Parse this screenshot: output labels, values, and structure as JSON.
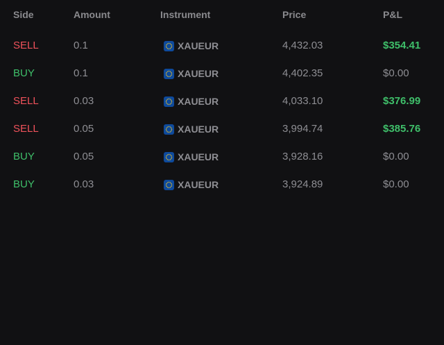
{
  "header": {
    "side": "Side",
    "amount": "Amount",
    "instrument": "Instrument",
    "price": "Price",
    "pnl": "P&L"
  },
  "colors": {
    "sell": "#f0525b",
    "buy": "#3fbf6a",
    "profit": "#3fbf6a",
    "neutral": "#8e8e93",
    "background": "#111113",
    "flag": "#0e4a9c"
  },
  "rows": [
    {
      "side": "SELL",
      "amount": "0.1",
      "instrument": "XAUEUR",
      "instrument_icon": "eu-flag-icon",
      "price": "4,432.03",
      "pnl": "$354.41"
    },
    {
      "side": "BUY",
      "amount": "0.1",
      "instrument": "XAUEUR",
      "instrument_icon": "eu-flag-icon",
      "price": "4,402.35",
      "pnl": "$0.00"
    },
    {
      "side": "SELL",
      "amount": "0.03",
      "instrument": "XAUEUR",
      "instrument_icon": "eu-flag-icon",
      "price": "4,033.10",
      "pnl": "$376.99"
    },
    {
      "side": "SELL",
      "amount": "0.05",
      "instrument": "XAUEUR",
      "instrument_icon": "eu-flag-icon",
      "price": "3,994.74",
      "pnl": "$385.76"
    },
    {
      "side": "BUY",
      "amount": "0.05",
      "instrument": "XAUEUR",
      "instrument_icon": "eu-flag-icon",
      "price": "3,928.16",
      "pnl": "$0.00"
    },
    {
      "side": "BUY",
      "amount": "0.03",
      "instrument": "XAUEUR",
      "instrument_icon": "eu-flag-icon",
      "price": "3,924.89",
      "pnl": "$0.00"
    }
  ]
}
